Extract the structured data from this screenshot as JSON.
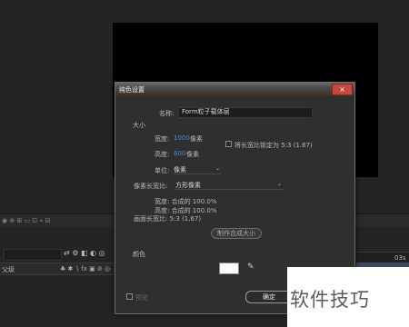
{
  "dialog": {
    "title": "纯色设置",
    "close_icon": "×",
    "name_label": "名称:",
    "name_value": "Form粒子载体层",
    "size_section": "大小",
    "width_label": "宽度:",
    "width_value": "1000",
    "width_unit": "像素",
    "height_label": "高度:",
    "height_value": "600",
    "height_unit": "像素",
    "lock_ratio_label": "将长宽比锁定为 5:3 (1.67)",
    "units_label": "单位:",
    "units_value": "像素",
    "pixel_aspect_label": "像素长宽比:",
    "pixel_aspect_value": "方形像素",
    "info_width": "宽度: 合成的 100.0%",
    "info_height": "高度: 合成的 100.0%",
    "info_frame_aspect": "画面长宽比: 5:3 (1.67)",
    "make_comp_size_button": "制作合成大小",
    "color_label": "颜色",
    "color_value": "#ffffff",
    "preview_label": "预览",
    "ok_button": "确定"
  },
  "background": {
    "layer_name_header": "父级",
    "timeline_time": "03s"
  },
  "watermark": {
    "text": "软件技巧"
  },
  "colors": {
    "accent_blue": "#3f8fdd",
    "close_red": "#c9463b"
  }
}
